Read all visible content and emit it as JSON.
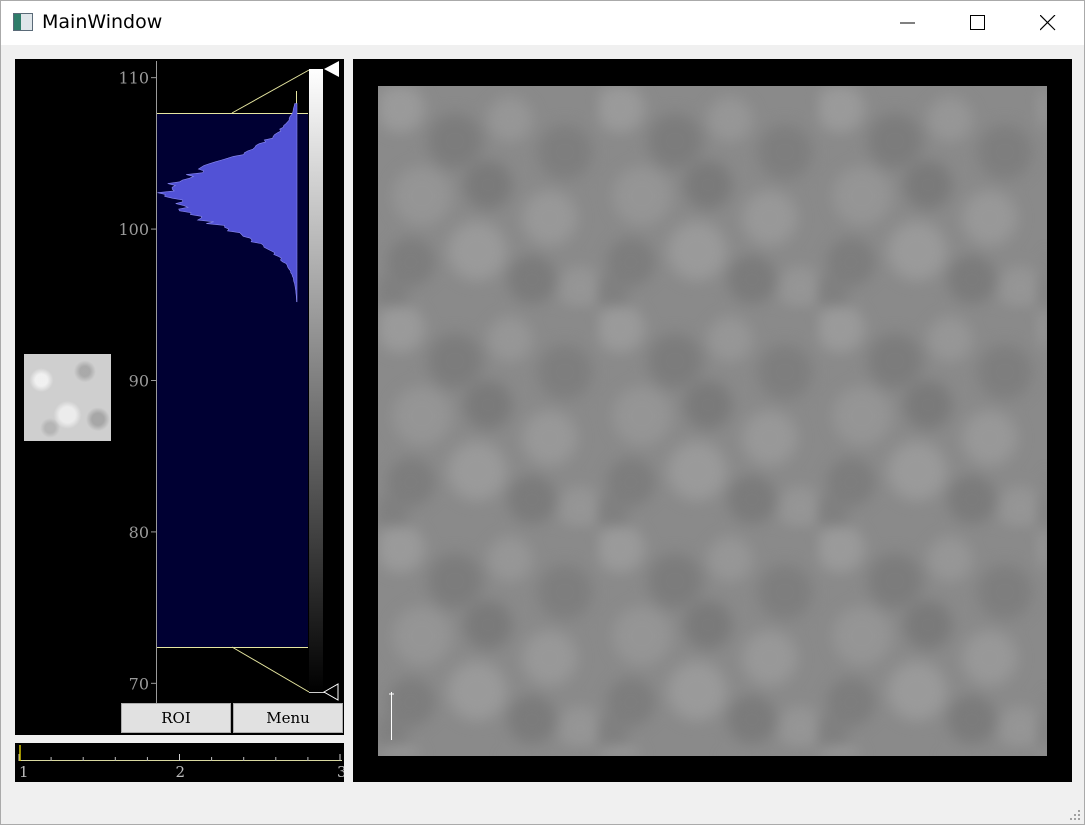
{
  "window": {
    "title": "MainWindow"
  },
  "histogram": {
    "axis_ticks": [
      "110",
      "100",
      "90",
      "80",
      "70"
    ],
    "tick_values": [
      110,
      100,
      90,
      80,
      70
    ],
    "axis_range": [
      68.7,
      111.1
    ],
    "level_range": [
      71,
      107.5
    ],
    "histogram_peak_value": 102.3,
    "colors": {
      "plot_bg": "#000033",
      "fill": "#5252d6",
      "axis": "#9a9a9a",
      "region_lines": "#e6e6a0"
    }
  },
  "buttons": {
    "roi_label": "ROI",
    "menu_label": "Menu"
  },
  "timeline": {
    "ticks": [
      "1",
      "2",
      "3"
    ],
    "tick_values": [
      1,
      2,
      3
    ],
    "current_value": 1
  },
  "image_view": {
    "description_icon": "scale-bar"
  }
}
